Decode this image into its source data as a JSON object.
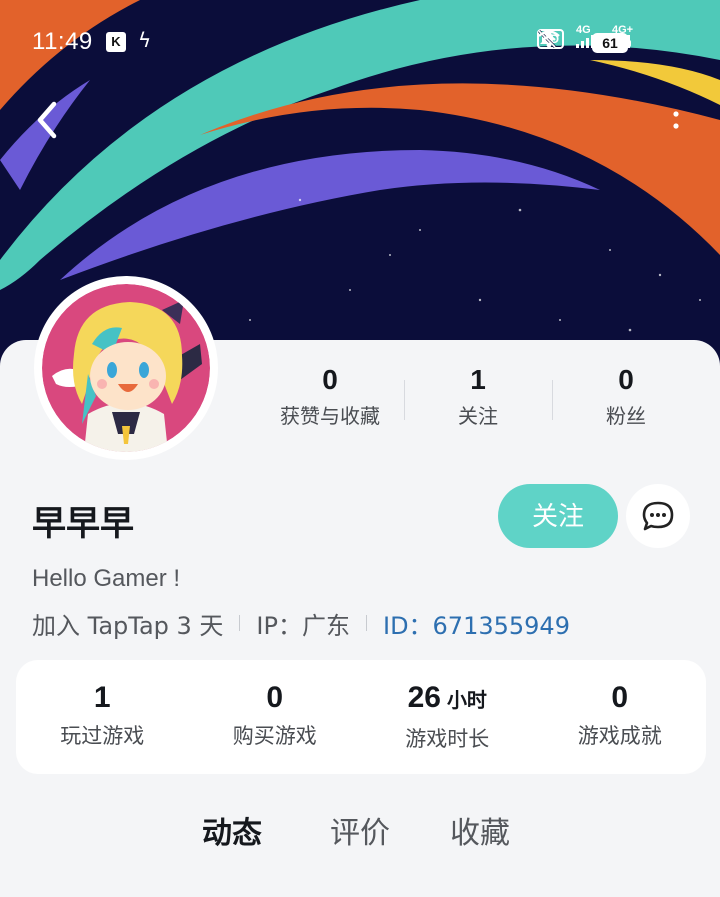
{
  "status_bar": {
    "time": "11:49",
    "k_badge": "K",
    "hd_label": "HD",
    "net1": "4G",
    "net2": "4G+",
    "battery": "61"
  },
  "nav": {
    "back_icon": "chevron-left-icon",
    "more_icon": "more-vertical-icon"
  },
  "profile": {
    "username": "早早早",
    "bio": "Hello Gamer !",
    "joined": "加入 TapTap 3 天",
    "ip": "IP：广东",
    "id": "ID：671355949"
  },
  "social_stats": [
    {
      "value": "0",
      "label": "获赞与收藏"
    },
    {
      "value": "1",
      "label": "关注"
    },
    {
      "value": "0",
      "label": "粉丝"
    }
  ],
  "actions": {
    "follow_label": "关注",
    "message_icon": "chat-bubble-icon"
  },
  "game_stats": [
    {
      "value": "1",
      "unit": "",
      "label": "玩过游戏"
    },
    {
      "value": "0",
      "unit": "",
      "label": "购买游戏"
    },
    {
      "value": "26",
      "unit": "小时",
      "label": "游戏时长"
    },
    {
      "value": "0",
      "unit": "",
      "label": "游戏成就"
    }
  ],
  "tabs": [
    {
      "label": "动态",
      "active": true
    },
    {
      "label": "评价",
      "active": false
    },
    {
      "label": "收藏",
      "active": false
    }
  ],
  "colors": {
    "accent": "#5fd3c7",
    "banner_bg": "#0b0d3a",
    "id_link": "#2d6fb0"
  }
}
